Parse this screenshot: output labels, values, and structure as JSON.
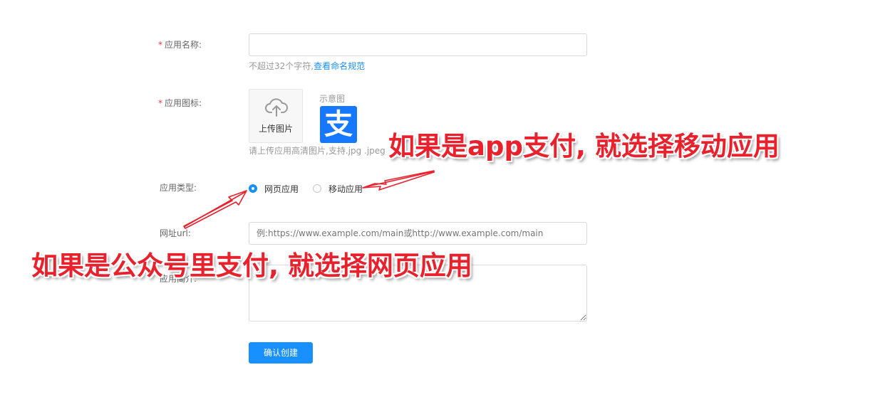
{
  "form": {
    "app_name": {
      "required_mark": "*",
      "label": "应用名称:",
      "value": "",
      "hint_prefix": "不超过32个字符,",
      "hint_link": "查看命名规范"
    },
    "app_icon": {
      "required_mark": "*",
      "label": "应用图标:",
      "upload_label": "上传图片",
      "upload_icon": "cloud-upload-icon",
      "example_label": "示意图",
      "example_icon": "alipay-logo",
      "example_glyph": "支",
      "hint": "请上传应用高清图片,支持.jpg .jpeg"
    },
    "app_type": {
      "label": "应用类型:",
      "options": [
        {
          "label": "网页应用",
          "selected": true
        },
        {
          "label": "移动应用",
          "selected": false
        }
      ]
    },
    "url": {
      "label": "网址url:",
      "placeholder": "例:https://www.example.com/main或http://www.example.com/main"
    },
    "intro": {
      "label": "应用简介:",
      "value": ""
    },
    "submit_label": "确认创建"
  },
  "annotations": {
    "mobile_note": "如果是app支付, 就选择移动应用",
    "web_note": "如果是公众号里支付, 就选择网页应用"
  },
  "colors": {
    "accent": "#1890ff",
    "required": "#e6393f",
    "annotation": "#e8212c",
    "alipay_blue": "#1677ff"
  }
}
